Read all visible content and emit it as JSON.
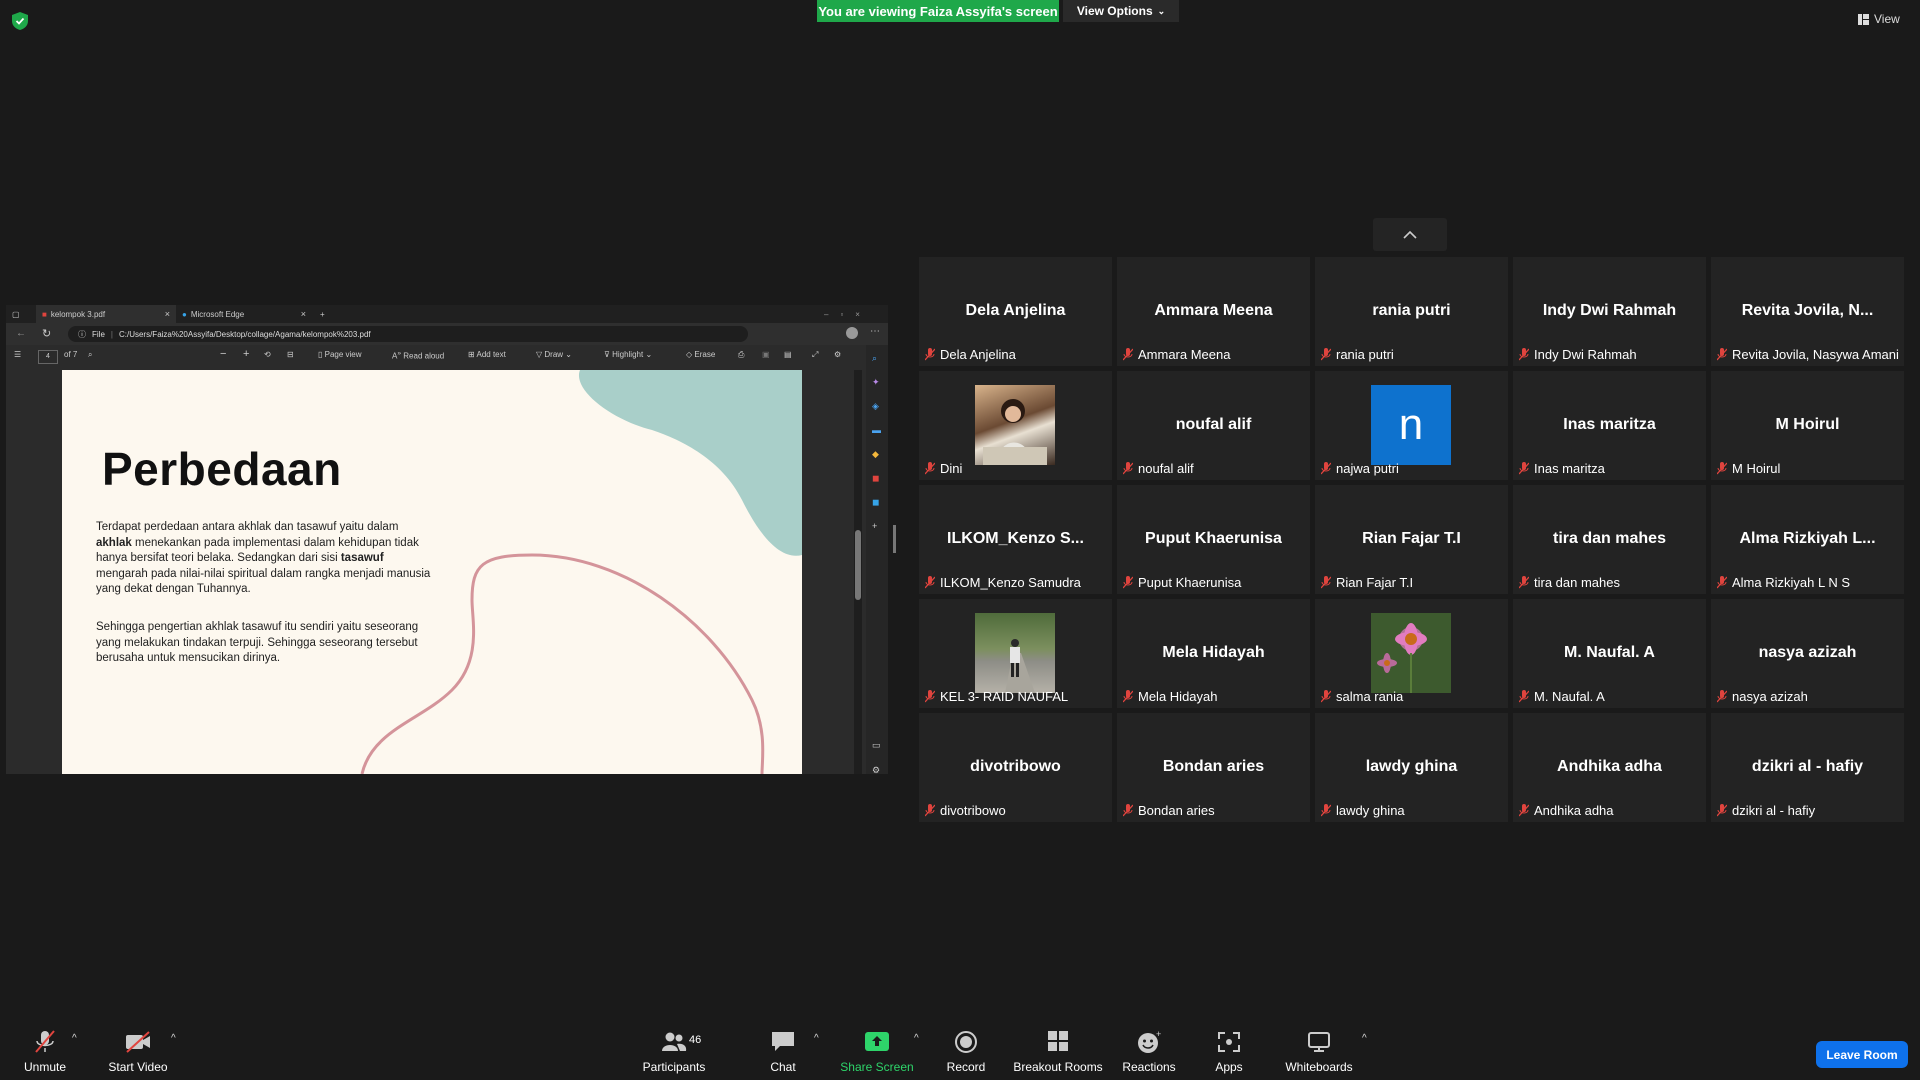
{
  "top": {
    "banner": "You are viewing Faiza Assyifa's screen",
    "view_options": "View Options",
    "view": "View"
  },
  "browser": {
    "tabs": [
      "kelompok 3.pdf",
      "Microsoft Edge"
    ],
    "file_label": "File",
    "url": "C:/Users/Faiza%20Assyifa/Desktop/collage/Agama/kelompok%203.pdf",
    "page_current": "4",
    "page_total": "of 7",
    "tools": [
      "Page view",
      "Read aloud",
      "Add text",
      "Draw",
      "Highlight",
      "Erase"
    ]
  },
  "slide": {
    "title": "Perbedaan",
    "p1_a": "Terdapat perdedaan antara akhlak dan tasawuf yaitu dalam ",
    "p1_b": "akhlak",
    "p1_c": " menekankan pada implementasi dalam kehidupan tidak hanya bersifat teori belaka. Sedangkan dari sisi ",
    "p1_d": "tasawuf",
    "p1_e": " mengarah pada nilai-nilai spiritual dalam rangka menjadi manusia yang dekat dengan Tuhannya.",
    "p2": "Sehingga pengertian akhlak tasawuf itu sendiri yaitu seseorang yang melakukan tindakan terpuji. Sehingga seseorang tersebut berusaha untuk mensucikan dirinya."
  },
  "participants": [
    {
      "big": "Dela Anjelina",
      "label": "Dela Anjelina"
    },
    {
      "big": "Ammara Meena",
      "label": "Ammara Meena"
    },
    {
      "big": "rania putri",
      "label": "rania putri"
    },
    {
      "big": "Indy Dwi Rahmah",
      "label": "Indy Dwi Rahmah"
    },
    {
      "big": "Revita Jovila, N...",
      "label": "Revita Jovila, Nasywa Amani"
    },
    {
      "big": "",
      "label": "Dini"
    },
    {
      "big": "noufal alif",
      "label": "noufal alif"
    },
    {
      "big": "n",
      "label": "najwa putri"
    },
    {
      "big": "Inas maritza",
      "label": "Inas maritza"
    },
    {
      "big": "M Hoirul",
      "label": "M Hoirul"
    },
    {
      "big": "ILKOM_Kenzo S...",
      "label": "ILKOM_Kenzo Samudra"
    },
    {
      "big": "Puput Khaerunisa",
      "label": "Puput Khaerunisa"
    },
    {
      "big": "Rian Fajar T.I",
      "label": "Rian Fajar T.I"
    },
    {
      "big": "tira dan mahes",
      "label": "tira dan mahes"
    },
    {
      "big": "Alma Rizkiyah L...",
      "label": "Alma Rizkiyah L N S"
    },
    {
      "big": "",
      "label": "KEL 3- RAID NAUFAL"
    },
    {
      "big": "Mela Hidayah",
      "label": "Mela Hidayah"
    },
    {
      "big": "",
      "label": "salma rania"
    },
    {
      "big": "M. Naufal. A",
      "label": "M. Naufal. A"
    },
    {
      "big": "nasya azizah",
      "label": "nasya azizah"
    },
    {
      "big": "divotribowo",
      "label": "divotribowo"
    },
    {
      "big": "Bondan aries",
      "label": "Bondan aries"
    },
    {
      "big": "lawdy ghina",
      "label": "lawdy ghina"
    },
    {
      "big": "Andhika adha",
      "label": "Andhika adha"
    },
    {
      "big": "dzikri al - hafiy",
      "label": "dzikri al - hafiy"
    }
  ],
  "toolbar": {
    "unmute": "Unmute",
    "start_video": "Start Video",
    "participants": "Participants",
    "participants_count": "46",
    "chat": "Chat",
    "share_screen": "Share Screen",
    "record": "Record",
    "breakout": "Breakout Rooms",
    "reactions": "Reactions",
    "apps": "Apps",
    "whiteboards": "Whiteboards",
    "leave": "Leave Room"
  },
  "colors": {
    "share_green": "#1fa84a",
    "leave_blue": "#0e71eb",
    "muted_red": "#e0443e",
    "avatar_blue": "#0e72ce"
  }
}
